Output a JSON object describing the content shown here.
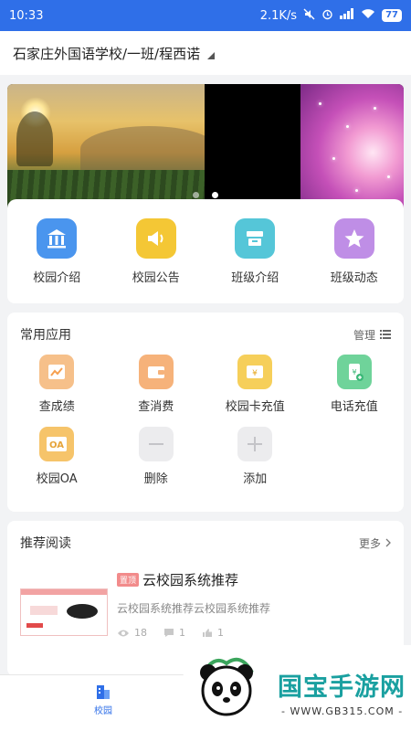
{
  "status_bar": {
    "time": "10:33",
    "speed": "2.1K/s",
    "battery": "77",
    "icons": [
      "mute-icon",
      "alarm-icon",
      "signal-icon",
      "wifi-icon",
      "battery-icon"
    ]
  },
  "header": {
    "school_path": "石家庄外国语学校/一班/程西诺"
  },
  "banner": {
    "slides": 3,
    "active_dot": 1
  },
  "quick_nav": [
    {
      "label": "校园介绍",
      "icon": "building-icon",
      "color": "#4a95ee"
    },
    {
      "label": "校园公告",
      "icon": "megaphone-icon",
      "color": "#f4c735"
    },
    {
      "label": "班级介绍",
      "icon": "classroom-icon",
      "color": "#55c6d8"
    },
    {
      "label": "班级动态",
      "icon": "star-icon",
      "color": "#bf8ee6"
    }
  ],
  "apps": {
    "title": "常用应用",
    "manage": "管理",
    "items": [
      {
        "label": "查成绩",
        "icon": "chart-icon",
        "color": "#f6c08a"
      },
      {
        "label": "查消费",
        "icon": "wallet-icon",
        "color": "#f6b27a"
      },
      {
        "label": "校园卡充值",
        "icon": "card-icon",
        "color": "#f6cf5a"
      },
      {
        "label": "电话充值",
        "icon": "phone-recharge-icon",
        "color": "#6fd39a"
      },
      {
        "label": "校园OA",
        "icon": "oa-icon",
        "color": "#f6c46a"
      },
      {
        "label": "删除",
        "icon": "minus-icon",
        "color": "#ececee"
      },
      {
        "label": "添加",
        "icon": "plus-icon",
        "color": "#ececee"
      }
    ]
  },
  "reading": {
    "title": "推荐阅读",
    "more": "更多",
    "article": {
      "pin": "置顶",
      "title": "云校园系统推荐",
      "desc": "云校园系统推荐云校园系统推荐",
      "views": "18",
      "comments": "1",
      "likes": "1"
    }
  },
  "bottom_nav": {
    "items": [
      {
        "label": "校园",
        "active": true
      }
    ]
  },
  "watermark": {
    "brand": "国宝手游网",
    "url": "- WWW.GB315.COM -"
  }
}
